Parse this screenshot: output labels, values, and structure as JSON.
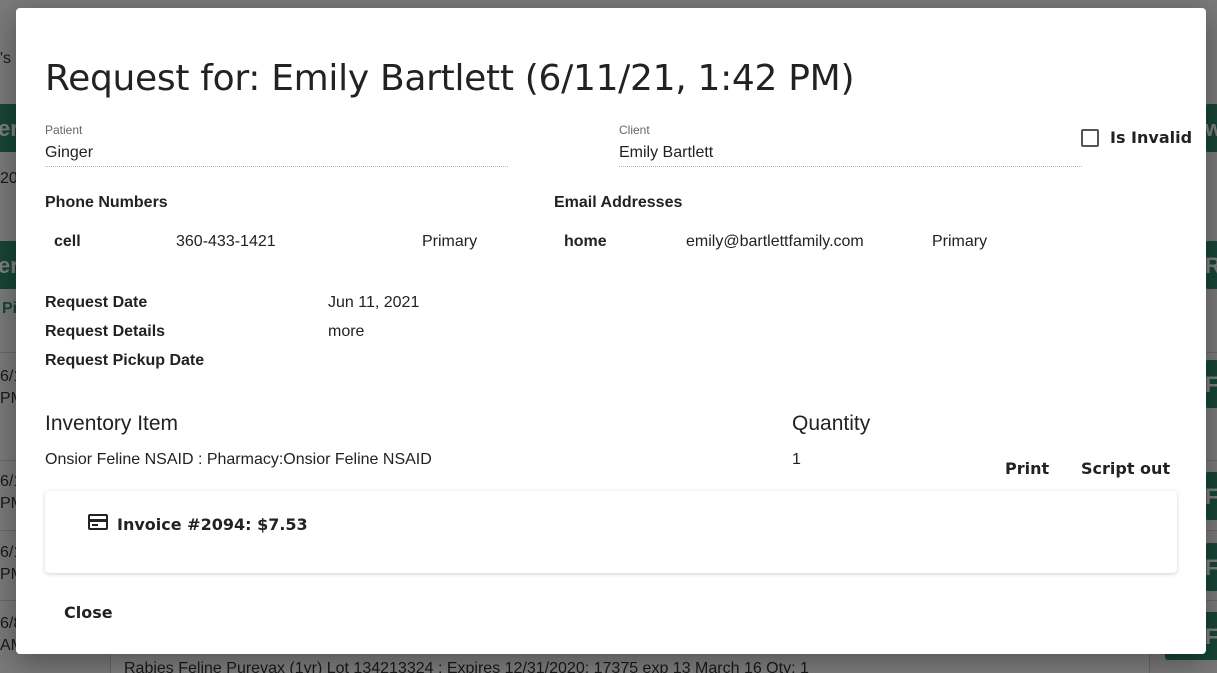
{
  "background": {
    "fragments": [
      "'s",
      "20",
      "er",
      "er",
      "Pi",
      "6/1",
      "PM",
      "6/1",
      "PM",
      "6/1",
      "PM",
      "6/8",
      "AM",
      "w",
      "Ro",
      "Fil",
      "Fil",
      "Fil",
      "Fil"
    ],
    "bottom_text": "Rabies Feline Purevax (1yr) Lot 134213324 : Expires 12/31/2020: 17375 exp 13 March 16 Qty: 1"
  },
  "modal": {
    "title": "Request for: Emily Bartlett (6/11/21, 1:42 PM)",
    "patient": {
      "label": "Patient",
      "value": "Ginger"
    },
    "client": {
      "label": "Client",
      "value": "Emily Bartlett"
    },
    "is_invalid_label": "Is Invalid",
    "phone": {
      "heading": "Phone Numbers",
      "items": [
        {
          "type": "cell",
          "number": "360-433-1421",
          "tag": "Primary"
        }
      ]
    },
    "email": {
      "heading": "Email Addresses",
      "items": [
        {
          "type": "home",
          "address": "emily@bartlettfamily.com",
          "tag": "Primary"
        }
      ]
    },
    "details": {
      "request_date": {
        "label": "Request Date",
        "value": "Jun 11, 2021"
      },
      "request_details": {
        "label": "Request Details",
        "value": "more"
      },
      "pickup_date": {
        "label": "Request Pickup Date",
        "value": ""
      }
    },
    "inventory": {
      "item_header": "Inventory Item",
      "qty_header": "Quantity",
      "rows": [
        {
          "name": "Onsior Feline NSAID : Pharmacy:Onsior Feline NSAID",
          "qty": "1"
        }
      ],
      "print_label": "Print",
      "script_out_label": "Script out"
    },
    "invoice": {
      "text": "Invoice #2094: $7.53"
    },
    "close_label": "Close"
  },
  "colors": {
    "accent_green": "#2e8b6f",
    "overlay": "rgba(0,0,0,0.5)"
  }
}
